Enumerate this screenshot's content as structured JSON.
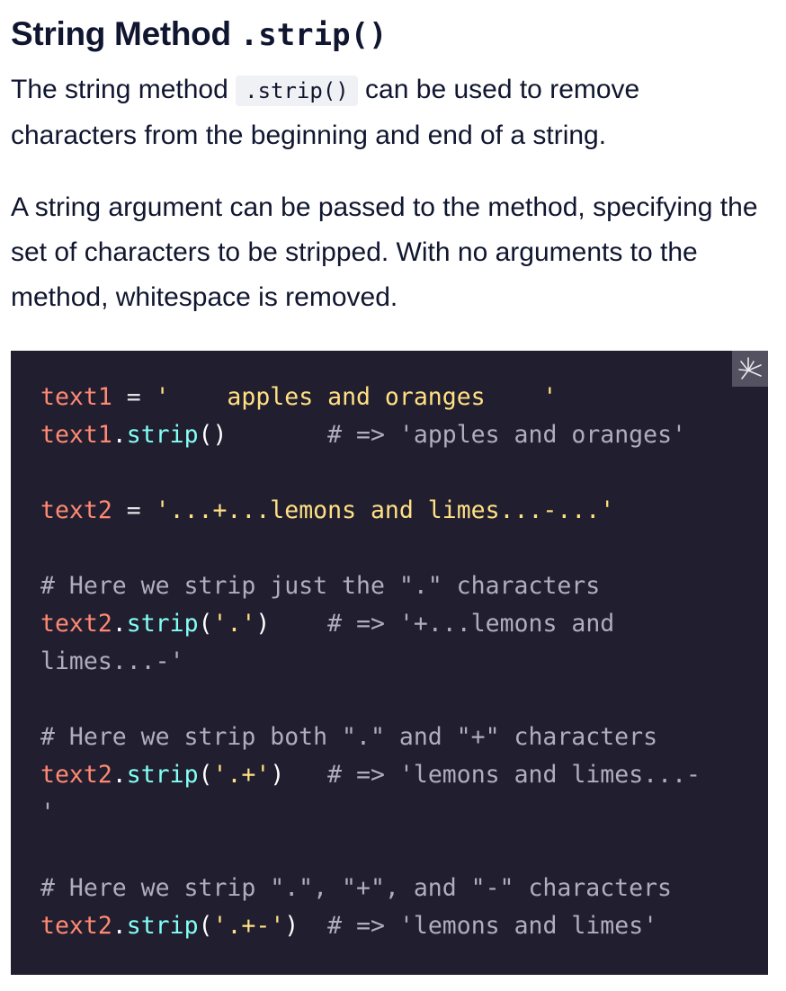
{
  "heading": {
    "prefix": "String Method ",
    "method": ".strip()"
  },
  "paragraph1": {
    "before": "The string method ",
    "code": ".strip()",
    "after": " can be used to remove characters from the beginning and end of a string."
  },
  "paragraph2": "A string argument can be passed to the method, specifying the set of characters to be stripped. With no arguments to the method, whitespace is removed.",
  "copy_button": {
    "icon": "sparkle-icon"
  },
  "code": {
    "l1_var": "text1",
    "l1_eq": " = ",
    "l1_str": "'    apples and oranges    '",
    "l2_var": "text1",
    "l2_dot": ".",
    "l2_fn": "strip",
    "l2_paren": "()",
    "l2_pad": "       ",
    "l2_comment": "# => 'apples and oranges'",
    "l4_var": "text2",
    "l4_eq": " = ",
    "l4_str": "'...+...lemons and limes...-...'",
    "l6_comment": "# Here we strip just the \".\" characters",
    "l7_var": "text2",
    "l7_dot": ".",
    "l7_fn": "strip",
    "l7_open": "(",
    "l7_arg": "'.'",
    "l7_close": ")",
    "l7_pad": "    ",
    "l7_comment": "# => '+...lemons and",
    "l8_comment": "limes...-'",
    "l10_comment": "# Here we strip both \".\" and \"+\" characters",
    "l11_var": "text2",
    "l11_dot": ".",
    "l11_fn": "strip",
    "l11_open": "(",
    "l11_arg": "'.+'",
    "l11_close": ")",
    "l11_pad": "   ",
    "l11_comment": "# => 'lemons and limes...-",
    "l12_comment": "'",
    "l14_comment": "# Here we strip \".\", \"+\", and \"-\" characters",
    "l15_var": "text2",
    "l15_dot": ".",
    "l15_fn": "strip",
    "l15_open": "(",
    "l15_arg": "'.+-'",
    "l15_close": ")",
    "l15_pad": "  ",
    "l15_comment": "# => 'lemons and limes'"
  },
  "colors": {
    "code_background": "#211e2f",
    "variable": "#ff8973",
    "function": "#83fff5",
    "string": "#ffe083",
    "comment": "#b0aebc",
    "text": "#10162f"
  }
}
